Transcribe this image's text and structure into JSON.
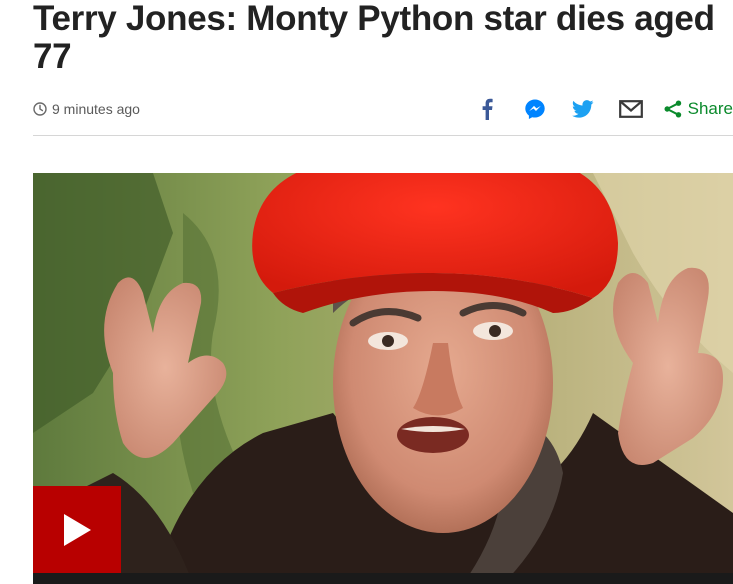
{
  "article": {
    "headline": "Terry Jones: Monty Python star dies aged 77",
    "timestamp": "9 minutes ago"
  },
  "share": {
    "label": "Share",
    "icons": [
      "facebook-icon",
      "messenger-icon",
      "twitter-icon",
      "email-icon",
      "share-icon"
    ]
  },
  "media": {
    "play_icon": "play-icon"
  },
  "colors": {
    "headline": "#222222",
    "facebook": "#3b5998",
    "messenger": "#0084ff",
    "twitter": "#1da1f2",
    "email": "#3a3a3a",
    "share": "#0b8a2c",
    "play_button": "#b80000"
  }
}
